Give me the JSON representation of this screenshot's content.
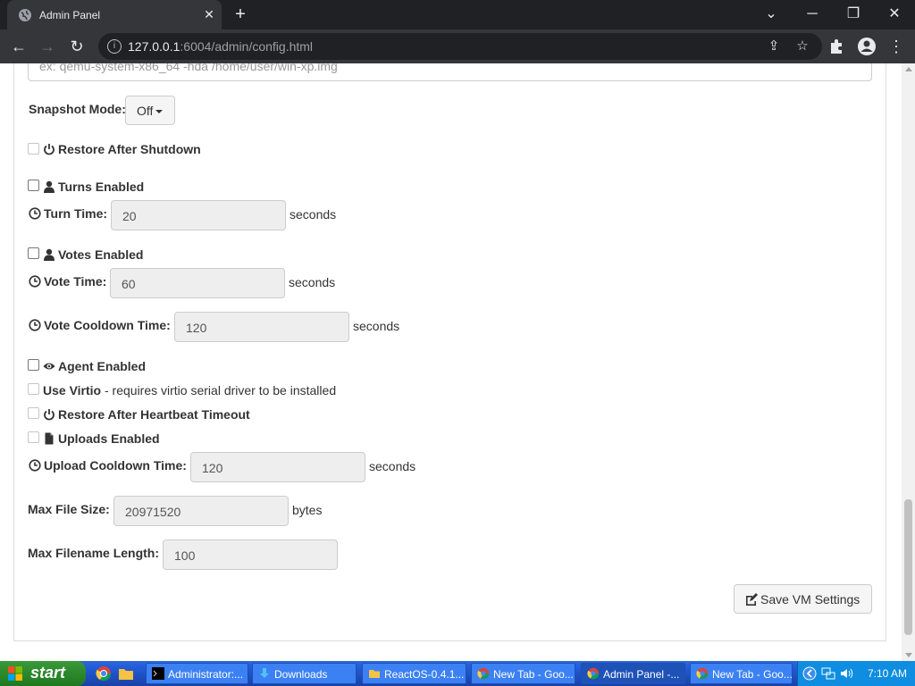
{
  "browser": {
    "tab_title": "Admin Panel",
    "url_host": "127.0.0.1",
    "url_path": ":6004/admin/config.html"
  },
  "form": {
    "cmdline_placeholder": "ex: qemu-system-x86_64 -hda /home/user/win-xp.img",
    "snapshot_label": "Snapshot Mode:",
    "snapshot_value": "Off",
    "restore_shutdown_label": "Restore After Shutdown",
    "turns_label": "Turns Enabled",
    "turn_time_label": "Turn Time:",
    "turn_time_value": "20",
    "seconds": "seconds",
    "votes_label": "Votes Enabled",
    "vote_time_label": "Vote Time:",
    "vote_time_value": "60",
    "vote_cooldown_label": "Vote Cooldown Time:",
    "vote_cooldown_value": "120",
    "agent_label": "Agent Enabled",
    "virtio_label": "Use Virtio",
    "virtio_note": " - requires virtio serial driver to be installed",
    "restore_heartbeat_label": "Restore After Heartbeat Timeout",
    "uploads_label": "Uploads Enabled",
    "upload_cooldown_label": "Upload Cooldown Time:",
    "upload_cooldown_value": "120",
    "max_file_size_label": "Max File Size:",
    "max_file_size_value": "20971520",
    "bytes": "bytes",
    "max_filename_label": "Max Filename Length:",
    "max_filename_value": "100",
    "save_label": "Save VM Settings"
  },
  "taskbar": {
    "start_label": "start",
    "items": [
      {
        "label": "Administrator:..."
      },
      {
        "label": "Downloads"
      },
      {
        "label": "ReactOS-0.4.1..."
      },
      {
        "label": "New Tab - Goo..."
      },
      {
        "label": "Admin Panel -..."
      },
      {
        "label": "New Tab - Goo..."
      }
    ],
    "clock": "7:10 AM"
  }
}
